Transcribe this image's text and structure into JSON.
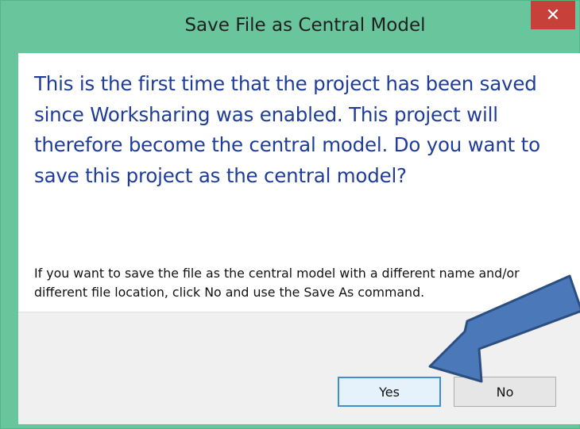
{
  "dialog": {
    "title": "Save File as Central Model",
    "close_label": "✕",
    "main_instruction": "This is the first time that the project has been saved since Worksharing was enabled. This project will therefore become the central model. Do you want to save this project as the central model?",
    "secondary_text": "If you want to save the file as the central model with a different name and/or different file location, click No and use the Save As command.",
    "buttons": {
      "yes_label": "Yes",
      "no_label": "No"
    }
  },
  "colors": {
    "frame": "#69c59b",
    "close_button": "#c7413a",
    "instruction_text": "#1e3c98",
    "annotation_arrow": "#4a78b8"
  },
  "icons": {
    "close": "close-icon",
    "annotation": "pointer-arrow-icon"
  }
}
